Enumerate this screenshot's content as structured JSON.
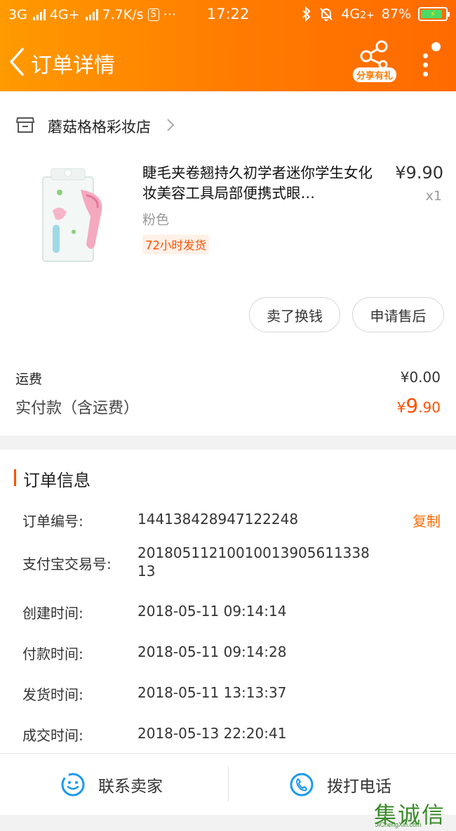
{
  "statusbar": {
    "network1": "3G",
    "network2": "4G+",
    "speed": "7.7K/s",
    "s_badge": "S",
    "dots": "···",
    "time": "17:22",
    "network3": "4G",
    "sim2": "2+",
    "battery": "87%"
  },
  "header": {
    "title": "订单详情",
    "share_label": "分享有礼"
  },
  "shop": {
    "name": "蘑菇格格彩妆店"
  },
  "product": {
    "title": "睫毛夹卷翘持久初学者迷你学生女化妆美容工具局部便携式眼…",
    "price": "¥9.90",
    "qty": "x1",
    "sku": "粉色",
    "tag": "72小时发货"
  },
  "actions": {
    "sell": "卖了换钱",
    "after_sale": "申请售后"
  },
  "fees": {
    "shipping_label": "运费",
    "shipping_value": "¥0.00",
    "paid_label": "实付款（含运费）",
    "paid_symbol": "¥",
    "paid_int": "9",
    "paid_dec": ".90"
  },
  "order_info": {
    "title": "订单信息",
    "copy_label": "复制",
    "rows": [
      {
        "label": "订单编号:",
        "value": "144138428947122248"
      },
      {
        "label": "支付宝交易号:",
        "value": "2018051121001001390561133813"
      },
      {
        "label": "创建时间:",
        "value": "2018-05-11 09:14:14"
      },
      {
        "label": "付款时间:",
        "value": "2018-05-11 09:14:28"
      },
      {
        "label": "发货时间:",
        "value": "2018-05-11 13:13:37"
      },
      {
        "label": "成交时间:",
        "value": "2018-05-13 22:20:41"
      }
    ]
  },
  "bottom": {
    "contact": "联系卖家",
    "call": "拨打电话"
  },
  "watermark": {
    "chars": "集诚信",
    "sub": "JiChengXin.com"
  },
  "colors": {
    "header_orange": "#ff7a00",
    "accent": "#ff5000",
    "icon_blue": "#1a9af0"
  }
}
